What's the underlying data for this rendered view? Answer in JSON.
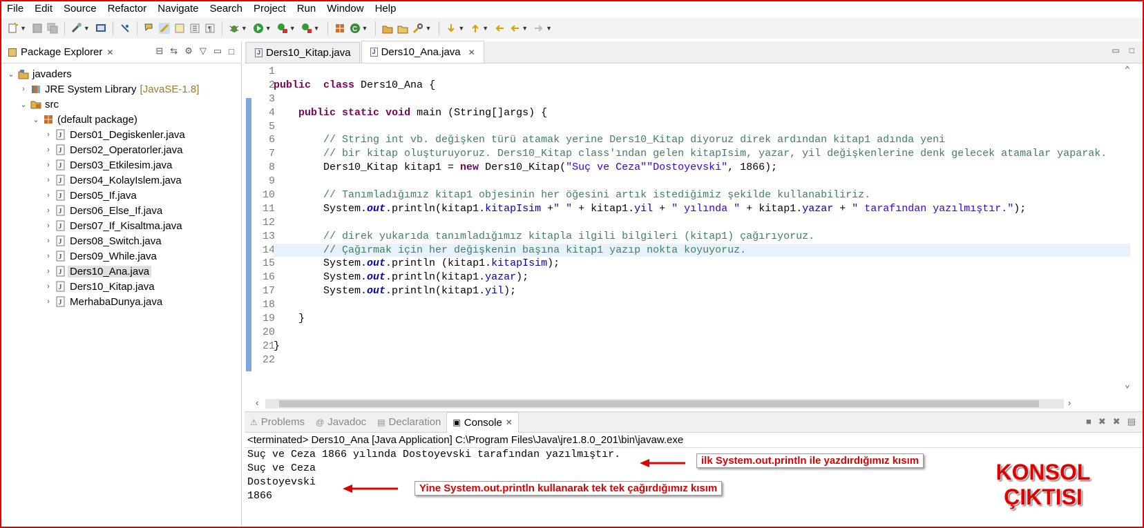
{
  "menu": [
    "File",
    "Edit",
    "Source",
    "Refactor",
    "Navigate",
    "Search",
    "Project",
    "Run",
    "Window",
    "Help"
  ],
  "package_explorer": {
    "title": "Package Explorer",
    "tree": [
      {
        "label": "javaders",
        "level": 0,
        "twisty": "v",
        "icon": "project"
      },
      {
        "label": "JRE System Library",
        "tag": "[JavaSE-1.8]",
        "level": 1,
        "twisty": ">",
        "icon": "library"
      },
      {
        "label": "src",
        "level": 1,
        "twisty": "v",
        "icon": "folder"
      },
      {
        "label": "(default package)",
        "level": 2,
        "twisty": "v",
        "icon": "package"
      },
      {
        "label": "Ders01_Degiskenler.java",
        "level": 3,
        "twisty": ">",
        "icon": "java"
      },
      {
        "label": "Ders02_Operatorler.java",
        "level": 3,
        "twisty": ">",
        "icon": "java"
      },
      {
        "label": "Ders03_Etkilesim.java",
        "level": 3,
        "twisty": ">",
        "icon": "java"
      },
      {
        "label": "Ders04_KolayIslem.java",
        "level": 3,
        "twisty": ">",
        "icon": "java"
      },
      {
        "label": "Ders05_If.java",
        "level": 3,
        "twisty": ">",
        "icon": "java"
      },
      {
        "label": "Ders06_Else_If.java",
        "level": 3,
        "twisty": ">",
        "icon": "java"
      },
      {
        "label": "Ders07_If_Kisaltma.java",
        "level": 3,
        "twisty": ">",
        "icon": "java"
      },
      {
        "label": "Ders08_Switch.java",
        "level": 3,
        "twisty": ">",
        "icon": "java"
      },
      {
        "label": "Ders09_While.java",
        "level": 3,
        "twisty": ">",
        "icon": "java"
      },
      {
        "label": "Ders10_Ana.java",
        "level": 3,
        "twisty": ">",
        "icon": "java",
        "selected": true
      },
      {
        "label": "Ders10_Kitap.java",
        "level": 3,
        "twisty": ">",
        "icon": "java"
      },
      {
        "label": "MerhabaDunya.java",
        "level": 3,
        "twisty": ">",
        "icon": "java"
      }
    ]
  },
  "editor": {
    "tabs": [
      {
        "label": "Ders10_Kitap.java",
        "active": false
      },
      {
        "label": "Ders10_Ana.java",
        "active": true
      }
    ],
    "line_numbers": [
      "1",
      "2",
      "3",
      "4",
      "5",
      "6",
      "7",
      "8",
      "9",
      "10",
      "11",
      "12",
      "13",
      "14",
      "15",
      "16",
      "17",
      "18",
      "19",
      "20",
      "21",
      "22"
    ],
    "highlight_line": 14,
    "code": [
      [],
      [
        [
          "kw",
          "public"
        ],
        [
          "",
          "  "
        ],
        [
          "kw",
          "class"
        ],
        [
          "",
          " Ders10_Ana {"
        ]
      ],
      [],
      [
        [
          "",
          "    "
        ],
        [
          "kw",
          "public"
        ],
        [
          "",
          " "
        ],
        [
          "kw",
          "static"
        ],
        [
          "",
          " "
        ],
        [
          "kw",
          "void"
        ],
        [
          "",
          " main (String[]args) {"
        ]
      ],
      [],
      [
        [
          "cm",
          "        // String int vb. değişken türü atamak yerine Ders10_Kitap diyoruz direk ardından kitap1 adında yeni"
        ]
      ],
      [
        [
          "cm",
          "        // bir kitap oluşturuyoruz. Ders10_Kitap class'ından gelen kitapIsim, yazar, yil değişkenlerine denk gelecek atamalar yaparak."
        ]
      ],
      [
        [
          "",
          "        Ders10_Kitap kitap1 = "
        ],
        [
          "kw",
          "new"
        ],
        [
          "",
          " Ders10_Kitap("
        ],
        [
          "st",
          "\"Suç ve Ceza\""
        ],
        [
          ", "
        ],
        [
          "st",
          "\"Dostoyevski\""
        ],
        [
          "",
          ", 1866);"
        ]
      ],
      [],
      [
        [
          "cm",
          "        // Tanımladığımız kitap1 objesinin her öğesini artık istediğimiz şekilde kullanabiliriz."
        ]
      ],
      [
        [
          "",
          "        System."
        ],
        [
          "sf",
          "out"
        ],
        [
          "",
          ".println(kitap1."
        ],
        [
          "fd",
          "kitapIsim"
        ],
        [
          "",
          " +"
        ],
        [
          "st",
          "\" \""
        ],
        [
          "",
          " + kitap1."
        ],
        [
          "fd",
          "yil"
        ],
        [
          "",
          " + "
        ],
        [
          "st",
          "\" yılında \""
        ],
        [
          "",
          " + kitap1."
        ],
        [
          "fd",
          "yazar"
        ],
        [
          "",
          " + "
        ],
        [
          "st",
          "\" tarafından yazılmıştır.\""
        ],
        [
          "",
          ");"
        ]
      ],
      [],
      [
        [
          "cm",
          "        // direk yukarıda tanımladığımız kitapla ilgili bilgileri (kitap1) çağırıyoruz."
        ]
      ],
      [
        [
          "cm",
          "        // Çağırmak için her değişkenin başına kitap1 yazıp nokta koyuyoruz."
        ]
      ],
      [
        [
          "",
          "        System."
        ],
        [
          "sf",
          "out"
        ],
        [
          "",
          ".println (kitap1."
        ],
        [
          "fd",
          "kitapIsim"
        ],
        [
          "",
          ");"
        ]
      ],
      [
        [
          "",
          "        System."
        ],
        [
          "sf",
          "out"
        ],
        [
          "",
          ".println(kitap1."
        ],
        [
          "fd",
          "yazar"
        ],
        [
          "",
          ");"
        ]
      ],
      [
        [
          "",
          "        System."
        ],
        [
          "sf",
          "out"
        ],
        [
          "",
          ".println(kitap1."
        ],
        [
          "fd",
          "yil"
        ],
        [
          "",
          ");"
        ]
      ],
      [],
      [
        [
          "",
          "    }"
        ]
      ],
      [],
      [
        [
          "",
          "}"
        ]
      ],
      []
    ]
  },
  "console": {
    "tabs": [
      {
        "label": "Problems",
        "active": false
      },
      {
        "label": "Javadoc",
        "active": false
      },
      {
        "label": "Declaration",
        "active": false
      },
      {
        "label": "Console",
        "active": true
      }
    ],
    "terminated": "<terminated> Ders10_Ana [Java Application] C:\\Program Files\\Java\\jre1.8.0_201\\bin\\javaw.exe",
    "output": [
      "Suç ve Ceza 1866 yılında Dostoyevski tarafından yazılmıştır.",
      "Suç ve Ceza",
      "Dostoyevski",
      "1866"
    ]
  },
  "annotations": {
    "first": "ilk System.out.println ile yazdırdığımız kısım",
    "second": "Yine System.out.println kullanarak tek tek çağırdığımız kısım",
    "big_line1": "KONSOL",
    "big_line2": "ÇIKTISI"
  },
  "colors": {
    "annotation_red": "#e00000",
    "keyword": "#7f0055",
    "comment": "#3f7f5f",
    "string": "#2a00ff",
    "field": "#0000c0"
  }
}
